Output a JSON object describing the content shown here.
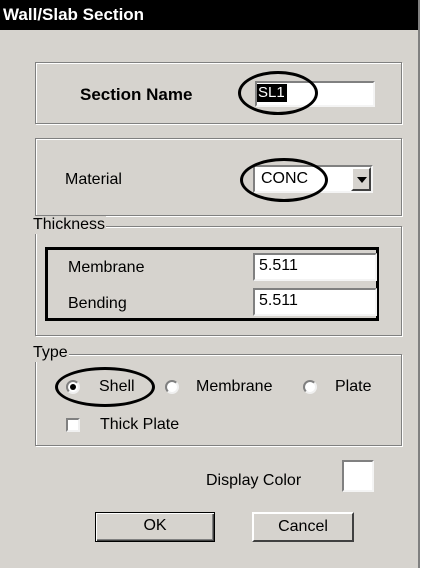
{
  "window": {
    "title": "Wall/Slab Section"
  },
  "section": {
    "label": "Section Name",
    "value": "SL1"
  },
  "material": {
    "label": "Material",
    "selected": "CONC"
  },
  "thickness": {
    "legend": "Thickness",
    "membrane_label": "Membrane",
    "membrane_value": "5.511",
    "bending_label": "Bending",
    "bending_value": "5.511"
  },
  "type": {
    "legend": "Type",
    "options": [
      "Shell",
      "Membrane",
      "Plate"
    ],
    "selected": "Shell",
    "thick_plate_label": "Thick Plate",
    "thick_plate_checked": false
  },
  "display_color": {
    "label": "Display Color",
    "value": "#ffffff"
  },
  "buttons": {
    "ok": "OK",
    "cancel": "Cancel"
  }
}
